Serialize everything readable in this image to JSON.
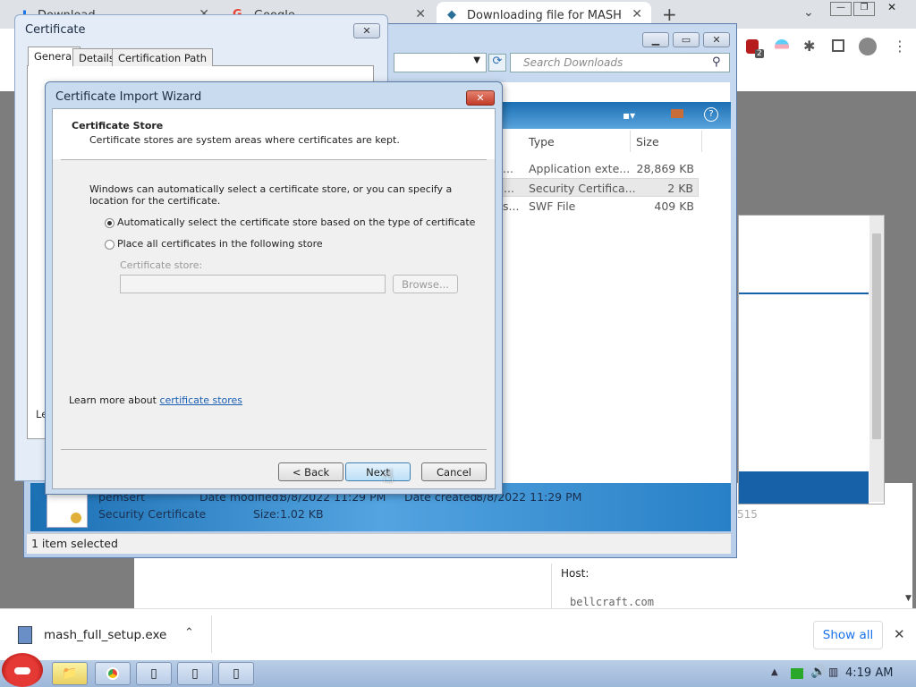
{
  "browser": {
    "tabs": [
      {
        "label": "Download",
        "favicon": "download-icon"
      },
      {
        "label": "Google",
        "favicon": "google-icon"
      },
      {
        "label": "Downloading file for MASH",
        "favicon": "mash-icon"
      }
    ],
    "new_tab": "+",
    "close_tab": "✕",
    "extension_badge": "2"
  },
  "explorer": {
    "search_placeholder": "Search Downloads",
    "columns": {
      "type": "Type",
      "size": "Size"
    },
    "rows": [
      {
        "name": "...",
        "type": "Application exte...",
        "size": "28,869 KB"
      },
      {
        "name": "...",
        "type": "Security Certifica...",
        "size": "2 KB"
      },
      {
        "name": "s...",
        "type": "SWF File",
        "size": "409 KB"
      }
    ],
    "details": {
      "file_name": "pemsert",
      "file_type": "Security Certificate",
      "date_modified_label": "Date modified:",
      "date_modified": "8/8/2022 11:29 PM",
      "date_created_label": "Date created:",
      "date_created": "8/8/2022 11:29 PM",
      "size_label": "Size:",
      "size": "1.02 KB"
    },
    "status": "1 item selected"
  },
  "certificate_window": {
    "title": "Certificate",
    "tabs": [
      "General",
      "Details",
      "Certification Path"
    ],
    "footer_fragment": "Le"
  },
  "wizard": {
    "title": "Certificate Import Wizard",
    "header_title": "Certificate Store",
    "header_desc": "Certificate stores are system areas where certificates are kept.",
    "intro": "Windows can automatically select a certificate store, or you can specify a location for the certificate.",
    "option_auto": "Automatically select the certificate store based on the type of certificate",
    "option_manual": "Place all certificates in the following store",
    "store_label": "Certificate store:",
    "store_value": "",
    "browse": "Browse...",
    "learn_prefix": "Learn more about ",
    "learn_link": "certificate stores",
    "back": "< Back",
    "next": "Next",
    "cancel": "Cancel"
  },
  "page": {
    "host_label": "Host:",
    "host_value": "bellcraft.com",
    "partial_number": "515"
  },
  "download_shelf": {
    "file": "mash_full_setup.exe",
    "show_all": "Show all"
  },
  "taskbar": {
    "clock": "4:19 AM"
  },
  "colors": {
    "accent_blue": "#1761a8",
    "wizard_frame": "#c9dbef",
    "link": "#1a5fb4"
  }
}
